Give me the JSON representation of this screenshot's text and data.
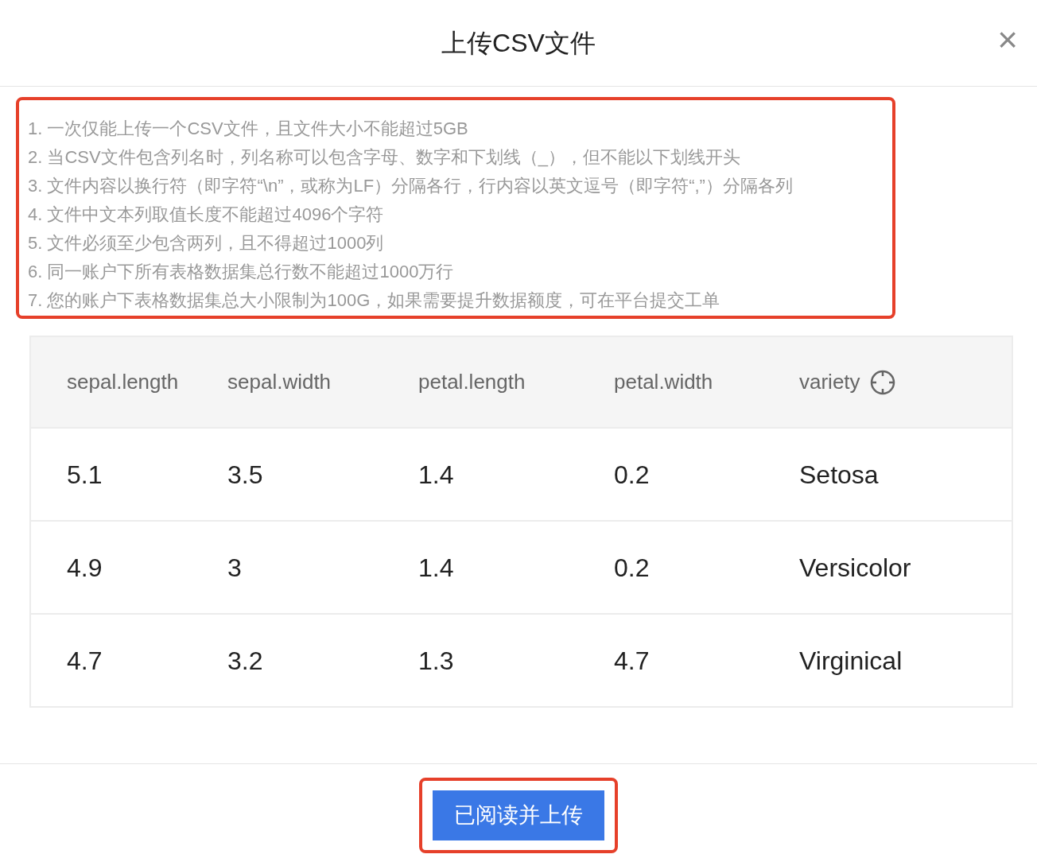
{
  "dialog": {
    "title": "上传CSV文件",
    "close": "×"
  },
  "notes": [
    "1. 一次仅能上传一个CSV文件，且文件大小不能超过5GB",
    "2. 当CSV文件包含列名时，列名称可以包含字母、数字和下划线（_），但不能以下划线开头",
    "3. 文件内容以换行符（即字符“\\n”，或称为LF）分隔各行，行内容以英文逗号（即字符“,”）分隔各列",
    "4. 文件中文本列取值长度不能超过4096个字符",
    "5. 文件必须至少包含两列，且不得超过1000列",
    "6. 同一账户下所有表格数据集总行数不能超过1000万行",
    "7. 您的账户下表格数据集总大小限制为100G，如果需要提升数据额度，可在平台提交工单"
  ],
  "table": {
    "columns": [
      {
        "label": "sepal.length",
        "kind": "plain"
      },
      {
        "label": "sepal.width",
        "kind": "plain"
      },
      {
        "label": "petal.length",
        "kind": "plain"
      },
      {
        "label": "petal.width",
        "kind": "plain"
      },
      {
        "label": "variety",
        "kind": "locate"
      }
    ],
    "rows": [
      [
        "5.1",
        "3.5",
        "1.4",
        "0.2",
        "Setosa"
      ],
      [
        "4.9",
        "3",
        "1.4",
        "0.2",
        "Versicolor"
      ],
      [
        "4.7",
        "3.2",
        "1.3",
        "4.7",
        "Virginical"
      ]
    ]
  },
  "button": "已阅读并上传"
}
